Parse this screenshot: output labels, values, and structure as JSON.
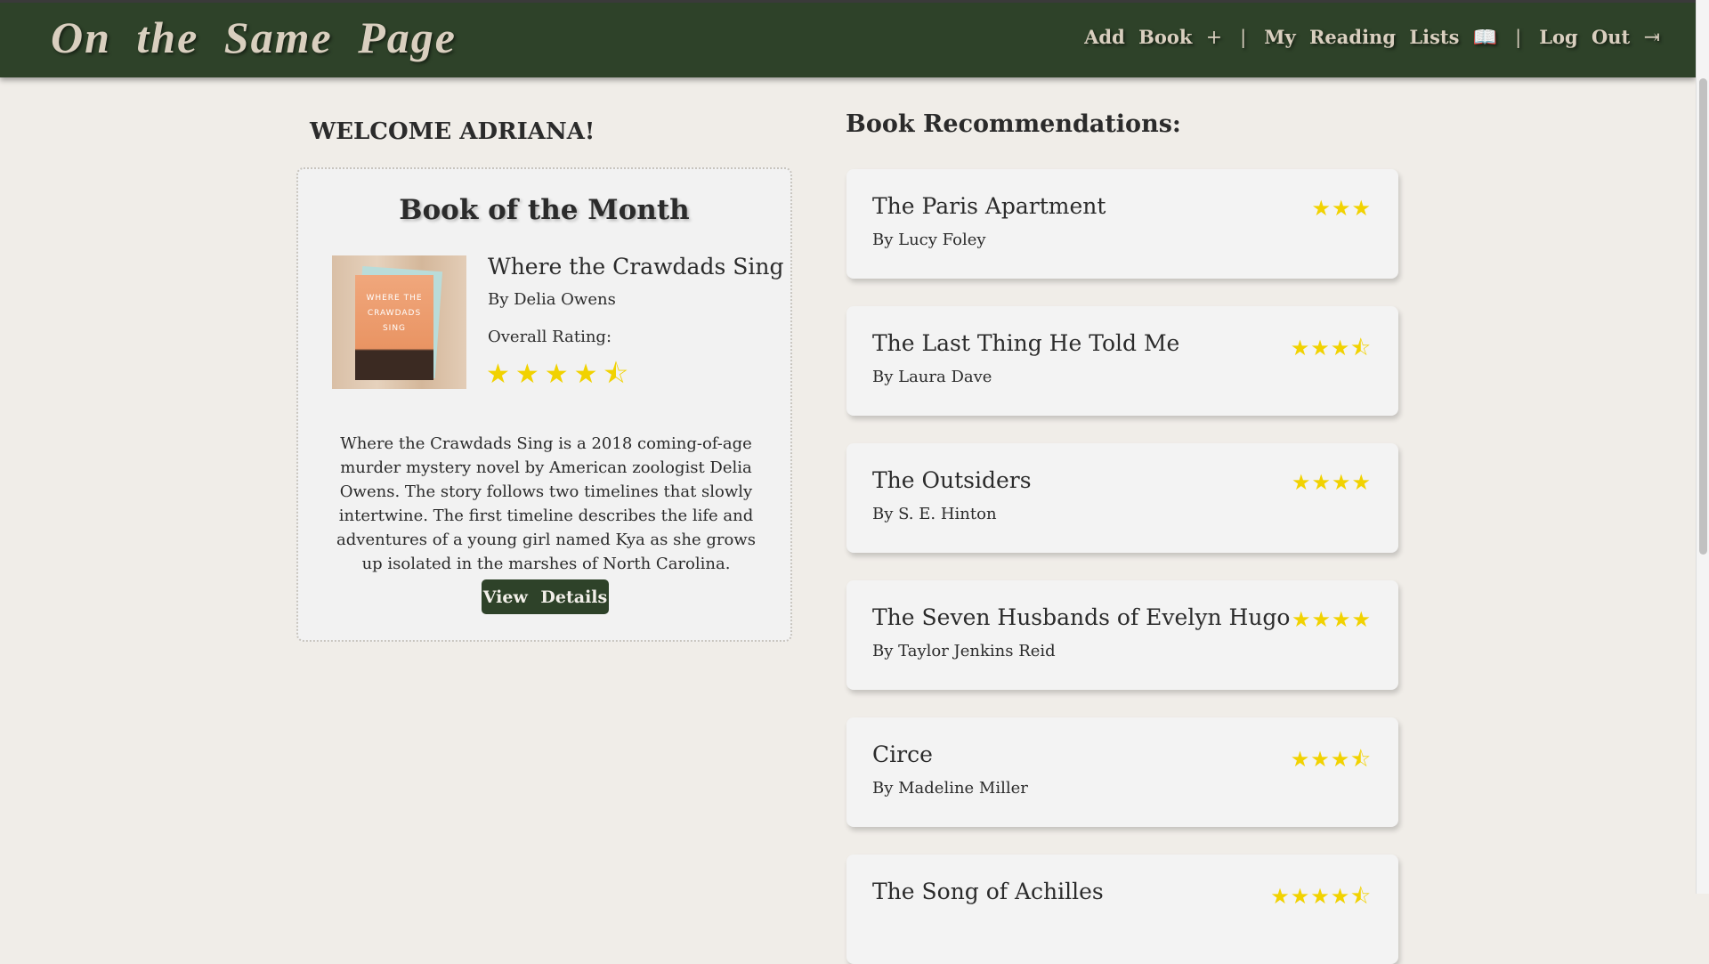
{
  "header": {
    "logo": "On the Same Page",
    "nav": [
      {
        "label": "Add Book",
        "icon": "+"
      },
      {
        "label": "My Reading Lists",
        "icon": "📖"
      },
      {
        "label": "Log Out",
        "icon": "⇥"
      }
    ],
    "separator": "|"
  },
  "welcome": "WELCOME ADRIANA!",
  "book_of_month": {
    "heading": "Book of the Month",
    "cover_text": "WHERE THE CRAWDADS SING",
    "title": "Where the Crawdads Sing",
    "author": "By Delia Owens",
    "rating_label": "Overall Rating:",
    "stars": "★★★★⯪",
    "rating": 4.5,
    "description": "Where the Crawdads Sing is a 2018 coming-of-age murder mystery novel by American zoologist Delia Owens. The story follows two timelines that slowly intertwine. The first timeline describes the life and adventures of a young girl named Kya as she grows up isolated in the marshes of North Carolina.",
    "button": "View Details"
  },
  "recommendations": {
    "heading": "Book Recommendations:",
    "items": [
      {
        "title": "The Paris Apartment",
        "author": "By Lucy Foley",
        "stars": "★★★",
        "rating": 3
      },
      {
        "title": "The Last Thing He Told Me",
        "author": "By Laura Dave",
        "stars": "★★★⯪",
        "rating": 3.5
      },
      {
        "title": "The Outsiders",
        "author": "By S. E. Hinton",
        "stars": "★★★★",
        "rating": 4
      },
      {
        "title": "The Seven Husbands of Evelyn Hugo",
        "author": "By Taylor Jenkins Reid",
        "stars": "★★★★",
        "rating": 4
      },
      {
        "title": "Circe",
        "author": "By Madeline Miller",
        "stars": "★★★⯪",
        "rating": 3.5
      },
      {
        "title": "The Song of Achilles",
        "author": "",
        "stars": "★★★★⯪",
        "rating": 4.5
      }
    ]
  }
}
